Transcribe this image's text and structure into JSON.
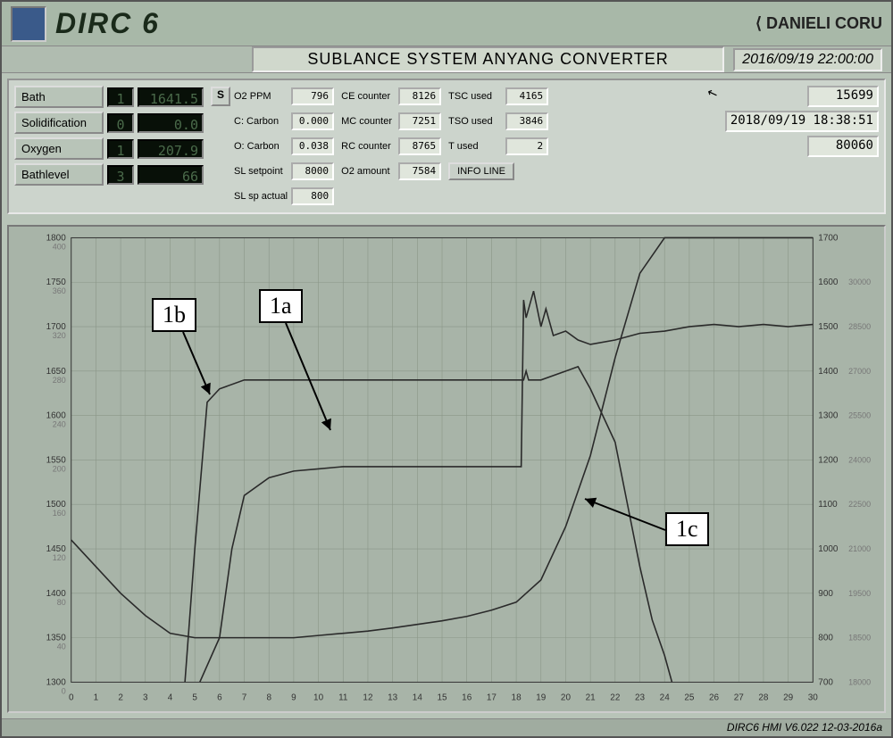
{
  "app": {
    "title": "DIRC 6",
    "brand": "⟨ DANIELI CORU"
  },
  "subheader": {
    "system": "SUBLANCE SYSTEM ANYANG CONVERTER",
    "datetime": "2016/09/19 22:00:00"
  },
  "left_panel": [
    {
      "label": "Bath",
      "idx": "1",
      "val": "1641.5"
    },
    {
      "label": "Solidification",
      "idx": "0",
      "val": "0.0"
    },
    {
      "label": "Oxygen",
      "idx": "1",
      "val": "207.9"
    },
    {
      "label": "Bathlevel",
      "idx": "3",
      "val": "66"
    }
  ],
  "s_btn": "S",
  "mid_col1": [
    {
      "label": "O2 PPM",
      "val": "796"
    },
    {
      "label": "C: Carbon",
      "val": "0.000"
    },
    {
      "label": "O: Carbon",
      "val": "0.038"
    },
    {
      "label": "SL setpoint",
      "val": "8000"
    },
    {
      "label": "SL sp actual",
      "val": "800"
    }
  ],
  "mid_col2": [
    {
      "label": "CE counter",
      "val": "8126"
    },
    {
      "label": "MC counter",
      "val": "7251"
    },
    {
      "label": "RC counter",
      "val": "8765"
    },
    {
      "label": "O2 amount",
      "val": "7584"
    }
  ],
  "mid_col3": [
    {
      "label": "TSC used",
      "val": "4165"
    },
    {
      "label": "TSO used",
      "val": "3846"
    },
    {
      "label": "T used",
      "val": "2"
    }
  ],
  "info_btn": "INFO LINE",
  "right_col": {
    "top_val": "15699",
    "datetime": "2018/09/19 18:38:51",
    "bottom_val": "80060"
  },
  "footer": "DIRC6 HMI V6.022 12-03-2016a",
  "chart_data": {
    "type": "line",
    "x": [
      0,
      1,
      2,
      3,
      4,
      5,
      6,
      7,
      8,
      9,
      10,
      11,
      12,
      13,
      14,
      15,
      16,
      17,
      18,
      19,
      20,
      21,
      22,
      23,
      24,
      25,
      26,
      27,
      28,
      29,
      30
    ],
    "x_ticks": [
      0,
      1,
      2,
      3,
      4,
      5,
      6,
      7,
      8,
      9,
      10,
      11,
      12,
      13,
      14,
      15,
      16,
      17,
      18,
      19,
      20,
      21,
      22,
      23,
      24,
      25,
      26,
      27,
      28,
      29,
      30
    ],
    "y_left_ticks": [
      1300,
      1350,
      1400,
      1450,
      1500,
      1550,
      1600,
      1650,
      1700,
      1750,
      1800
    ],
    "y_left2_ticks": [
      0,
      40,
      80,
      120,
      160,
      200,
      240,
      280,
      320,
      360,
      400
    ],
    "y_right_ticks": [
      700,
      800,
      900,
      1000,
      1100,
      1200,
      1300,
      1400,
      1500,
      1600,
      1700
    ],
    "y_right2_ticks": [
      18000,
      18500,
      19500,
      21000,
      22500,
      24000,
      25500,
      27000,
      28500,
      30000
    ],
    "series": [
      {
        "name": "1a",
        "axis": "right",
        "x": [
          5.2,
          6,
          6.5,
          7,
          8,
          9,
          10,
          11,
          12,
          13,
          14,
          15,
          16,
          17,
          17.5,
          18.2,
          18.3,
          18.4,
          18.7,
          19,
          19.2,
          19.5,
          20,
          20.5,
          21,
          22,
          23,
          24,
          25,
          26,
          27,
          28,
          29,
          30
        ],
        "y": [
          700,
          800,
          1000,
          1120,
          1160,
          1175,
          1180,
          1185,
          1185,
          1185,
          1185,
          1185,
          1185,
          1185,
          1185,
          1185,
          1560,
          1520,
          1580,
          1500,
          1540,
          1480,
          1490,
          1470,
          1460,
          1470,
          1485,
          1490,
          1500,
          1505,
          1500,
          1505,
          1500,
          1505
        ]
      },
      {
        "name": "1b",
        "axis": "right",
        "x": [
          4.6,
          5,
          5.5,
          6,
          7,
          8,
          9,
          10,
          11,
          12,
          13,
          14,
          15,
          16,
          17,
          18,
          18.3,
          18.4,
          18.5,
          19,
          20,
          20.5,
          21,
          22,
          22.5,
          23,
          23.5,
          24,
          24.3
        ],
        "y": [
          700,
          1000,
          1330,
          1360,
          1380,
          1380,
          1380,
          1380,
          1380,
          1380,
          1380,
          1380,
          1380,
          1380,
          1380,
          1380,
          1380,
          1400,
          1380,
          1380,
          1400,
          1410,
          1360,
          1240,
          1100,
          960,
          840,
          760,
          700
        ]
      },
      {
        "name": "1c",
        "axis": "right",
        "x": [
          0,
          1,
          2,
          3,
          4,
          5,
          6,
          7,
          8,
          9,
          10,
          11,
          12,
          13,
          14,
          15,
          16,
          17,
          18,
          19,
          20,
          21,
          22,
          23,
          24,
          30
        ],
        "y": [
          1020,
          960,
          900,
          850,
          810,
          800,
          800,
          800,
          800,
          800,
          805,
          810,
          815,
          822,
          830,
          838,
          848,
          862,
          880,
          930,
          1050,
          1210,
          1430,
          1620,
          1700,
          1700
        ]
      }
    ],
    "xlabel": "",
    "ylabel": "",
    "annotations": [
      "1a",
      "1b",
      "1c"
    ]
  }
}
